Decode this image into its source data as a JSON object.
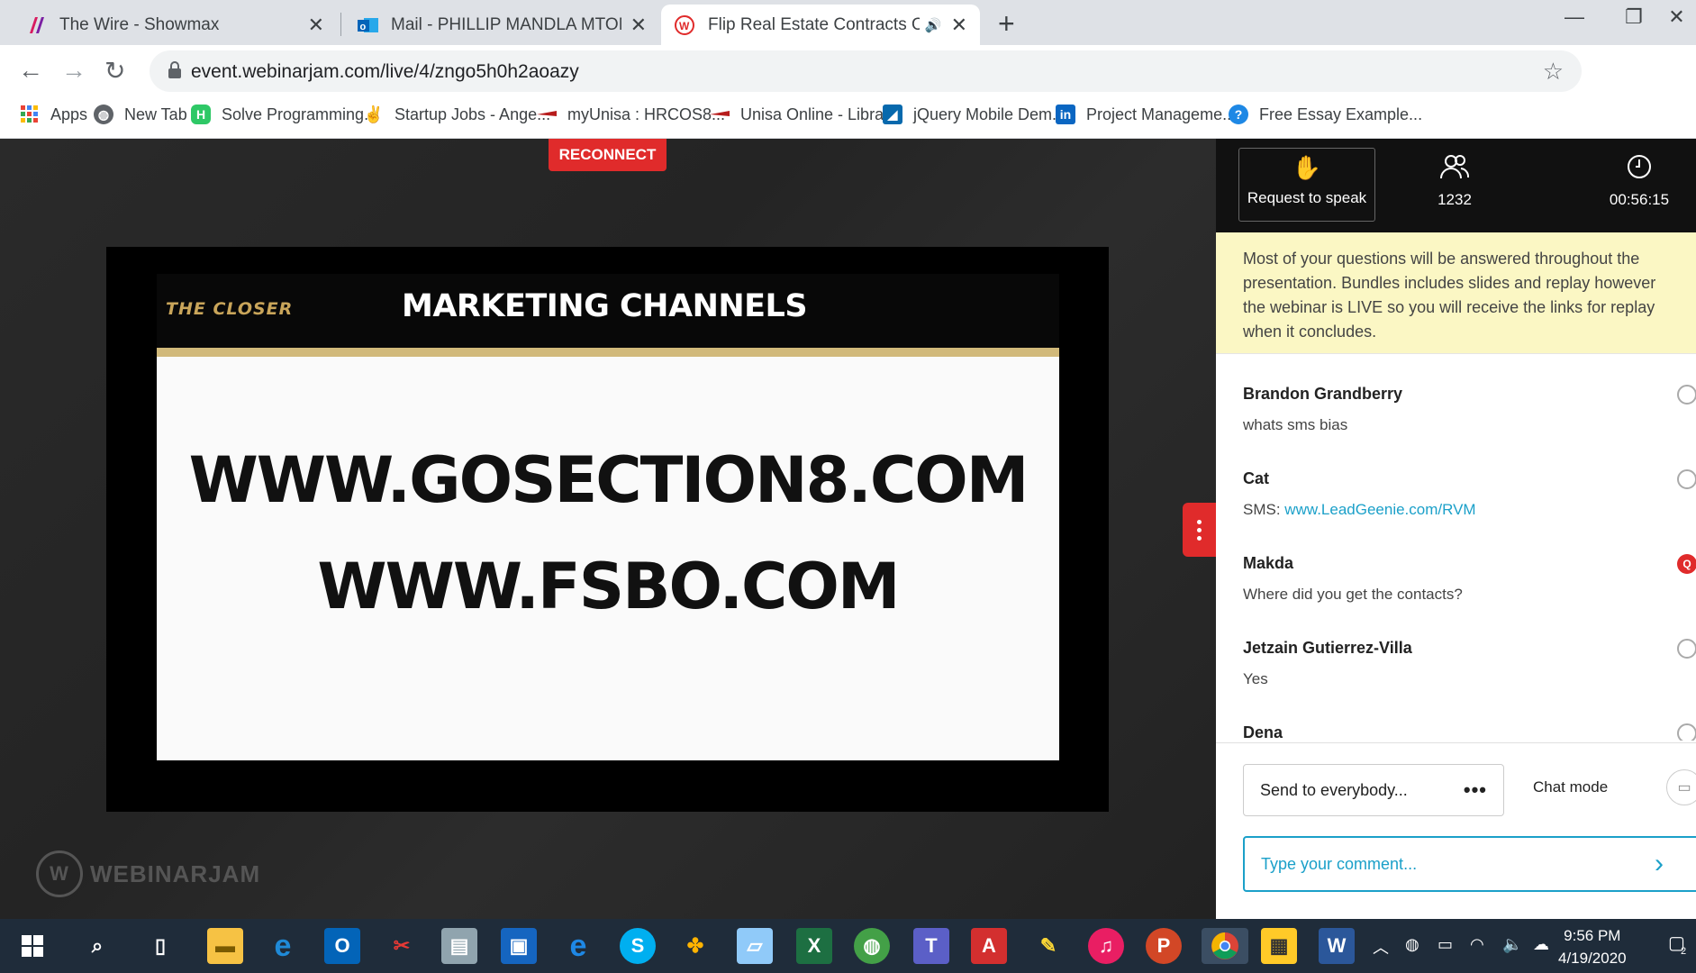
{
  "browser": {
    "tabs": [
      {
        "title": "The Wire - Showmax",
        "close": "✕"
      },
      {
        "title": "Mail - PHILLIP MANDLA MTOMBENI",
        "close": "✕"
      },
      {
        "title": "Flip Real Estate Contracts Of",
        "close": "✕",
        "active": true
      }
    ],
    "new_tab": "+",
    "window_controls": {
      "minimize": "—",
      "maximize": "❐",
      "close": "✕"
    },
    "url": "event.webinarjam.com/live/4/zngo5h0h2aoazy",
    "bookmarks": [
      {
        "label": "Apps"
      },
      {
        "label": "New Tab"
      },
      {
        "label": "Solve Programming..."
      },
      {
        "label": "Startup Jobs - Ange..."
      },
      {
        "label": "myUnisa : HRCOS8..."
      },
      {
        "label": "Unisa Online - Libra..."
      },
      {
        "label": "jQuery Mobile Dem..."
      },
      {
        "label": "Project Manageme..."
      },
      {
        "label": "Free Essay Example..."
      }
    ]
  },
  "webinar": {
    "reconnect_label": "RECONNECT",
    "slide": {
      "logo": "THE CLOSER",
      "title": "MARKETING CHANNELS",
      "lines": [
        "WWW.GOSECTION8.COM",
        "WWW.FSBO.COM"
      ]
    },
    "watermark": "WEBINARJAM"
  },
  "panel": {
    "request_to_speak": "Request to speak",
    "attendees": "1232",
    "elapsed": "00:56:15",
    "notice": "Most of your questions will be answered throughout the presentation. Bundles includes slides and replay however the webinar is LIVE so you will receive the links for replay when it concludes.",
    "messages": [
      {
        "name": "Brandon Grandberry",
        "text": "whats sms bias",
        "badge": ""
      },
      {
        "name": "Cat",
        "text": "SMS: ",
        "link": "www.LeadGeenie.com/RVM",
        "badge": ""
      },
      {
        "name": "Makda",
        "text": "Where did you get the contacts?",
        "badge": "Q"
      },
      {
        "name": "Jetzain Gutierrez-Villa",
        "text": "Yes",
        "badge": ""
      },
      {
        "name": "Dena",
        "text": "",
        "badge": ""
      }
    ],
    "send_to": "Send to everybody...",
    "send_to_more": "•••",
    "chat_mode": "Chat mode",
    "comment_placeholder": "Type your comment..."
  },
  "taskbar": {
    "time": "9:56 PM",
    "date": "4/19/2020",
    "notification_count": "2"
  },
  "colors": {
    "accent_red": "#e02b2b",
    "link_blue": "#1ba0c9",
    "notice_yellow": "#fbf7c4",
    "slide_gold": "#d1b97a"
  }
}
